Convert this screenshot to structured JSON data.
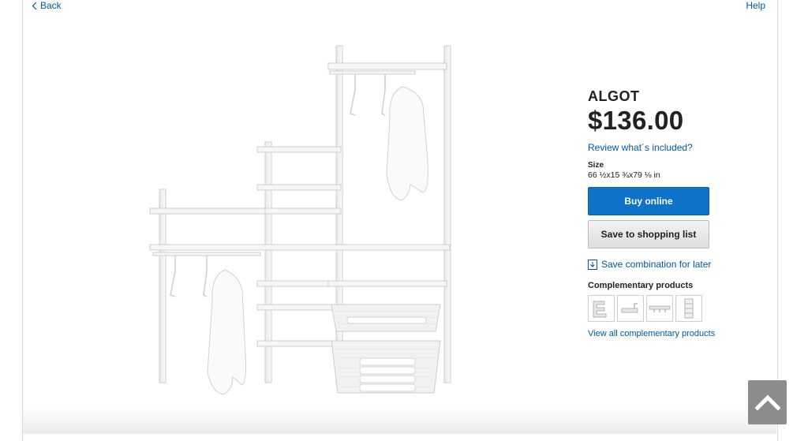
{
  "nav": {
    "back_label": "Back",
    "help_label": "Help"
  },
  "product": {
    "name": "ALGOT",
    "price": "$136.00",
    "review_link": "Review what´s included?",
    "size_label": "Size",
    "size_value": "66 ½x15 ¾x79 ⅛ in"
  },
  "actions": {
    "buy_label": "Buy online",
    "save_list_label": "Save to shopping list",
    "save_later_label": "Save combination for later"
  },
  "complementary": {
    "title": "Complementary products",
    "thumbnails": [
      "bracket-thumbnail",
      "hook-thumbnail",
      "hook-rail-thumbnail",
      "frame-thumbnail"
    ],
    "view_all_label": "View all complementary products"
  },
  "colors": {
    "link": "#0058a3",
    "buy_button": "#0d72c8",
    "scroll_button": "#8c8c8c"
  },
  "icons": {
    "back": "chevron-left-icon",
    "save_later": "download-icon",
    "scroll_top": "chevron-up-icon"
  }
}
